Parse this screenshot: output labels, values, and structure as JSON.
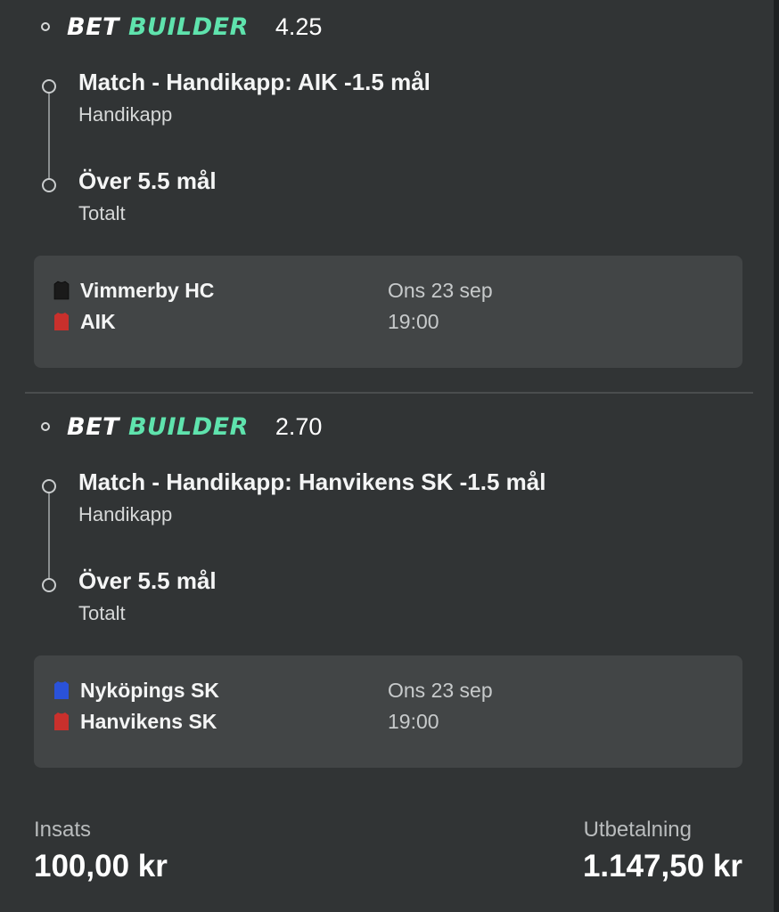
{
  "bets": [
    {
      "bet_label": "BET",
      "builder_label": "BUILDER",
      "odds": "4.25",
      "legs": [
        {
          "title": "Match - Handikapp: AIK -1.5 mål",
          "subtitle": "Handikapp"
        },
        {
          "title": "Över 5.5 mål",
          "subtitle": "Totalt"
        }
      ],
      "match": {
        "home_team": "Vimmerby HC",
        "away_team": "AIK",
        "date": "Ons 23 sep",
        "time": "19:00",
        "home_shirt_icon": "black-jersey-icon",
        "away_shirt_icon": "red-jersey-icon",
        "home_shirt_color": "#1a1a1a",
        "away_shirt_color": "#c9302c"
      }
    },
    {
      "bet_label": "BET",
      "builder_label": "BUILDER",
      "odds": "2.70",
      "legs": [
        {
          "title": "Match - Handikapp: Hanvikens SK -1.5 mål",
          "subtitle": "Handikapp"
        },
        {
          "title": "Över 5.5 mål",
          "subtitle": "Totalt"
        }
      ],
      "match": {
        "home_team": "Nyköpings SK",
        "away_team": "Hanvikens SK",
        "date": "Ons 23 sep",
        "time": "19:00",
        "home_shirt_icon": "blue-jersey-icon",
        "away_shirt_icon": "red-jersey-icon",
        "home_shirt_color": "#2a52d9",
        "away_shirt_color": "#c9302c"
      }
    }
  ],
  "footer": {
    "stake_label": "Insats",
    "stake_value": "100,00 kr",
    "payout_label": "Utbetalning",
    "payout_value": "1.147,50 kr"
  },
  "colors": {
    "background": "#313435",
    "card": "#424546",
    "builder_accent": "#5fe3ad"
  }
}
